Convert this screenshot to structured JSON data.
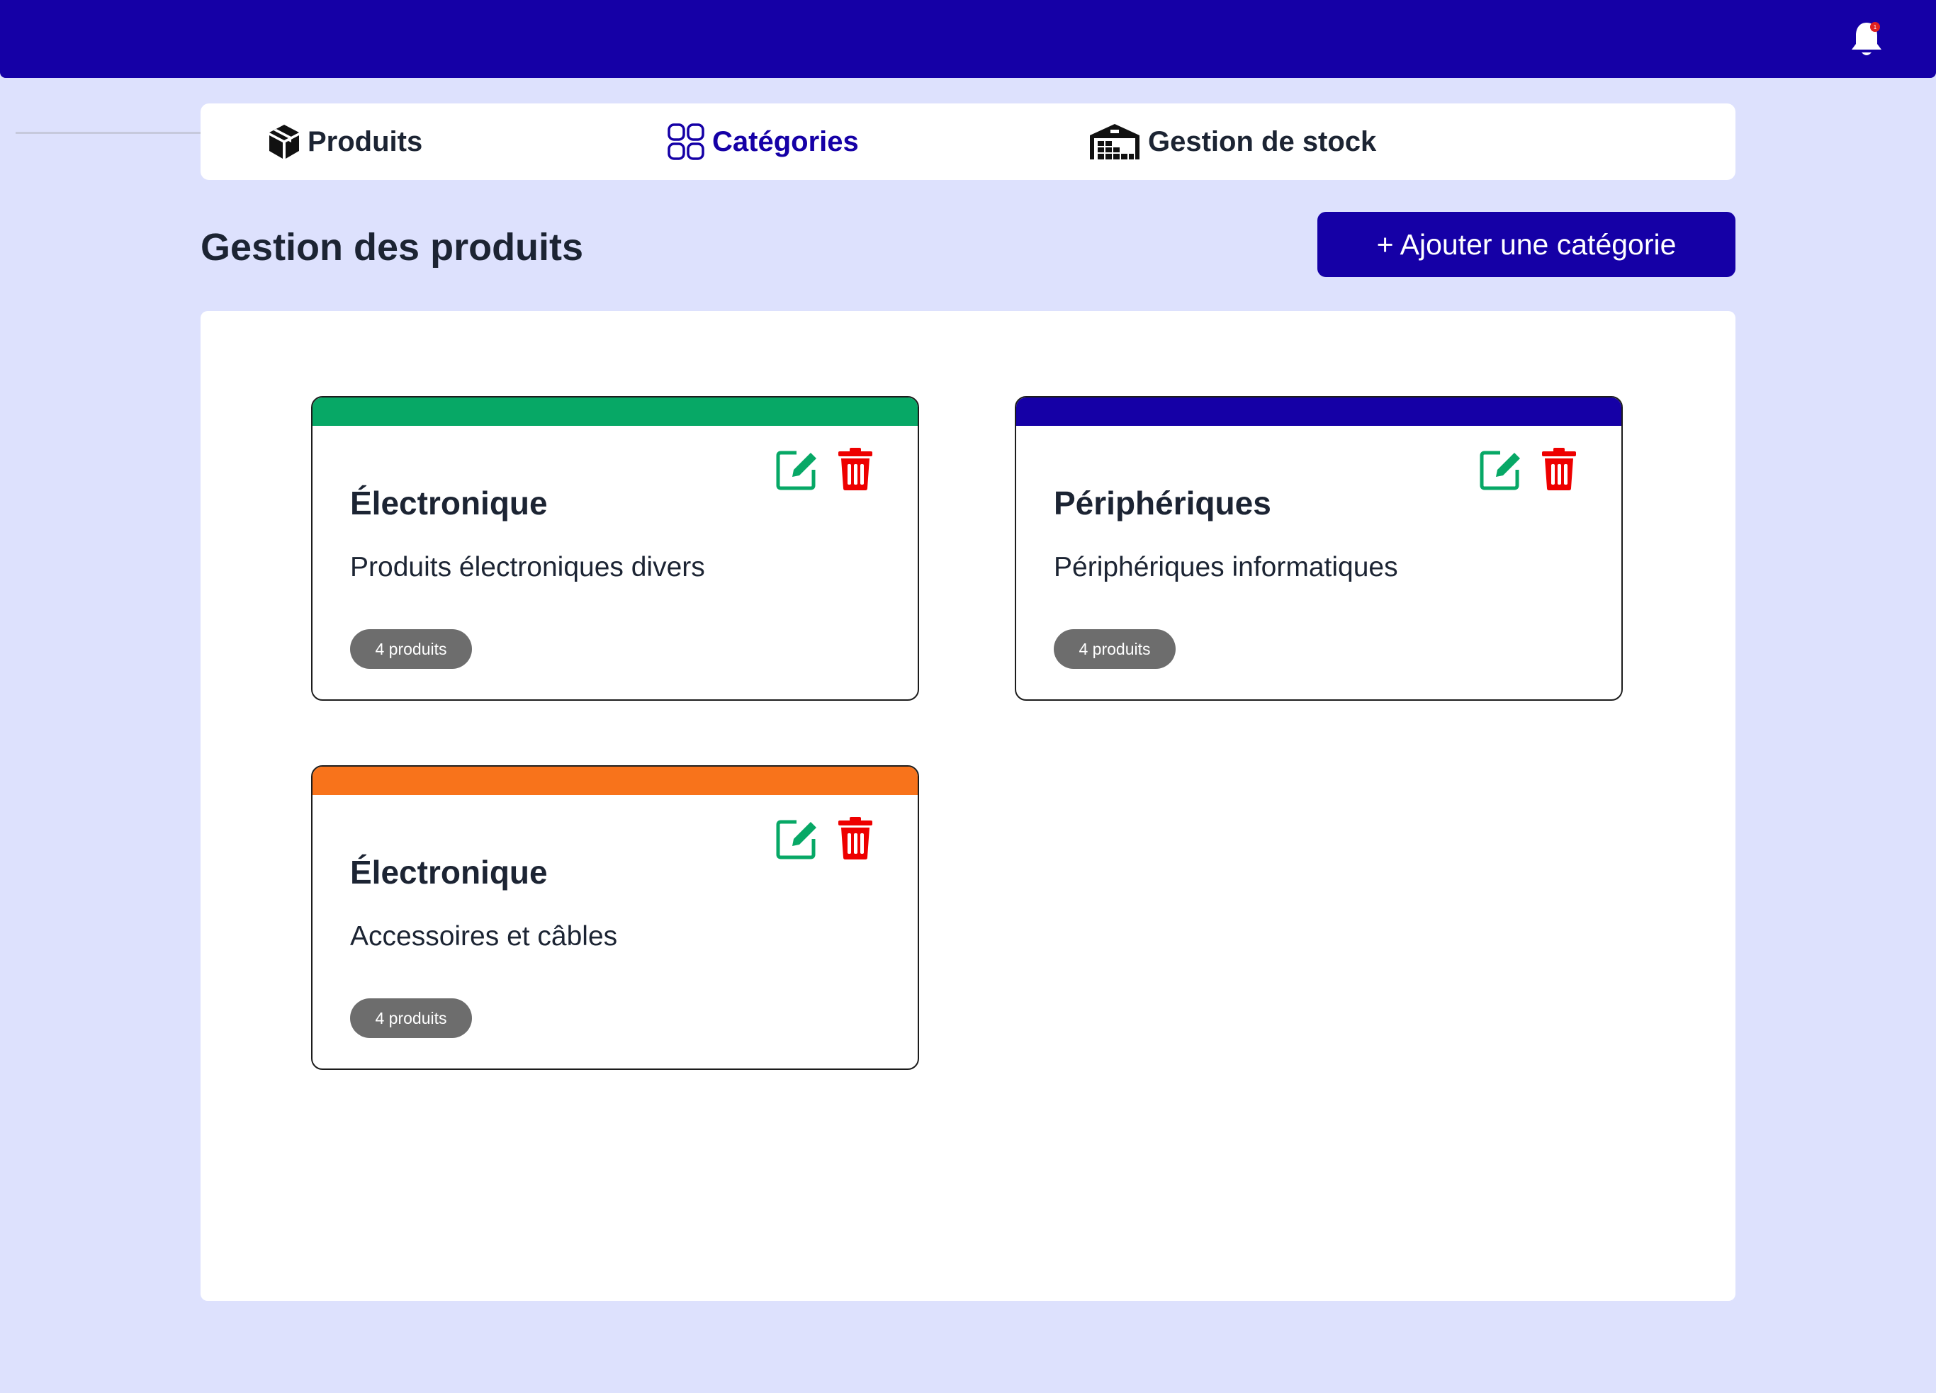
{
  "header": {
    "bg_color": "#1500a6",
    "notification_icon": "bell-icon",
    "notification_dot_color": "#e02020"
  },
  "tabs": [
    {
      "label": "Produits",
      "icon": "box-icon",
      "active": false
    },
    {
      "label": "Catégories",
      "icon": "grid-icon",
      "active": true
    },
    {
      "label": "Gestion de stock",
      "icon": "warehouse-icon",
      "active": false
    }
  ],
  "page": {
    "title": "Gestion des produits",
    "add_button": "+ Ajouter une catégorie"
  },
  "categories": [
    {
      "name": "Électronique",
      "description": "Produits électroniques divers",
      "count": "4 produits",
      "color": "#07a866"
    },
    {
      "name": "Périphériques",
      "description": "Périphériques informatiques",
      "count": "4 produits",
      "color": "#1500a6"
    },
    {
      "name": "Électronique",
      "description": "Accessoires et câbles",
      "count": "4 produits",
      "color": "#f8731b"
    }
  ],
  "colors": {
    "accent": "#1500a6",
    "background": "#dde1fd",
    "edit_icon": "#07a866",
    "delete_icon": "#ee0000",
    "badge": "#6d6d6d"
  }
}
